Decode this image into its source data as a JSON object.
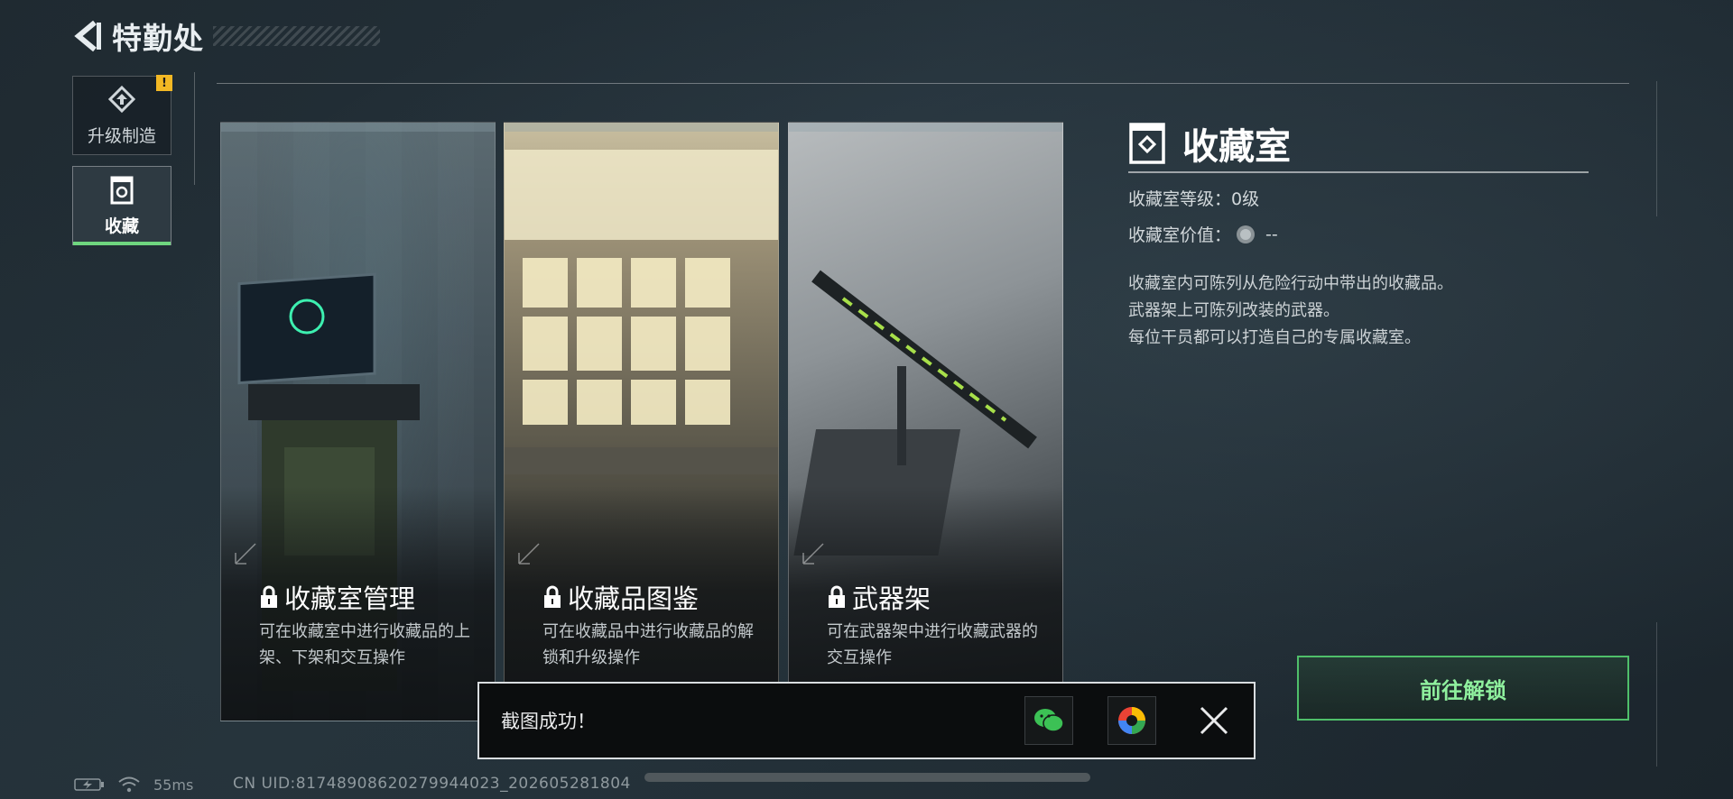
{
  "header": {
    "title": "特勤处"
  },
  "sidebar": {
    "items": [
      {
        "label": "升级制造",
        "icon": "upgrade-craft-icon",
        "badge": "!"
      },
      {
        "label": "收藏",
        "icon": "collection-icon",
        "active": true
      }
    ]
  },
  "cards": [
    {
      "title": "收藏室管理",
      "desc": "可在收藏室中进行收藏品的上架、下架和交互操作",
      "locked": true
    },
    {
      "title": "收藏品图鉴",
      "desc": "可在收藏品中进行收藏品的解锁和升级操作",
      "locked": true
    },
    {
      "title": "武器架",
      "desc": "可在武器架中进行收藏武器的交互操作",
      "locked": true
    }
  ],
  "info": {
    "title": "收藏室",
    "level_label": "收藏室等级：",
    "level_value": "0级",
    "value_label": "收藏室价值：",
    "value_value": "--",
    "desc_lines": [
      "收藏室内可陈列从危险行动中带出的收藏品。",
      "武器架上可陈列改装的武器。",
      "每位干员都可以打造自己的专属收藏室。"
    ],
    "unlock_button": "前往解锁"
  },
  "toast": {
    "message": "截图成功！"
  },
  "status": {
    "ping": "55ms",
    "uid": "CN UID:8174890862027994​4023_202605281804"
  },
  "colors": {
    "accent_green": "#6fd67f",
    "alert_yellow": "#f2b824"
  }
}
